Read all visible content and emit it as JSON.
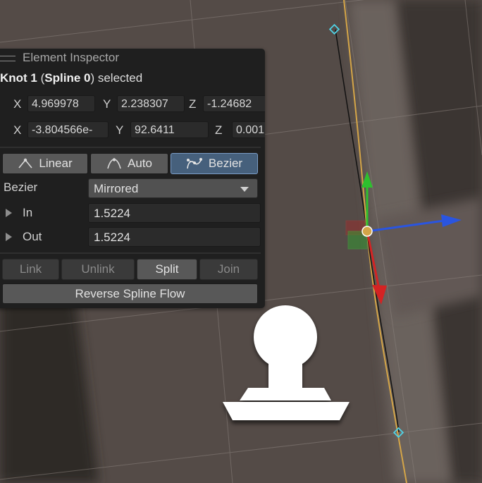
{
  "inspector": {
    "title": "Element Inspector",
    "selection": {
      "prefix": "Knot 1",
      "open_paren": " (",
      "spline": "Spline 0",
      "suffix": ") selected"
    },
    "position": {
      "x_label": "X",
      "x": "4.969978",
      "y_label": "Y",
      "y": "2.238307",
      "z_label": "Z",
      "z": "-1.24682"
    },
    "rotation": {
      "x_label": "X",
      "x": "-3.804566e-",
      "y_label": "Y",
      "y": "92.6411",
      "z_label": "Z",
      "z": "0.001"
    },
    "tangent_modes": [
      {
        "label": "Linear",
        "icon": "linear-tangent-icon",
        "active": false
      },
      {
        "label": "Auto",
        "icon": "auto-tangent-icon",
        "active": false
      },
      {
        "label": "Bezier",
        "icon": "bezier-tangent-icon",
        "active": true
      }
    ],
    "bezier_label": "Bezier",
    "bezier_mode": "Mirrored",
    "in_label": "In",
    "in_value": "1.5224",
    "out_label": "Out",
    "out_value": "1.5224",
    "tools": [
      {
        "label": "Link",
        "enabled": false
      },
      {
        "label": "Unlink",
        "enabled": false
      },
      {
        "label": "Split",
        "enabled": true
      },
      {
        "label": "Join",
        "enabled": false
      }
    ],
    "reverse_label": "Reverse Spline Flow"
  },
  "colors": {
    "panel": "#1f1f1f",
    "active_button": "#46607c",
    "spline": "#d4a548",
    "axis_x": "#d42323",
    "axis_y": "#2ec02e",
    "axis_z": "#2a55e0",
    "knot": "#4fd3e6"
  },
  "scene_icons": [
    "spline-knot-icon",
    "transform-gizmo-icon",
    "player-pawn-icon"
  ]
}
